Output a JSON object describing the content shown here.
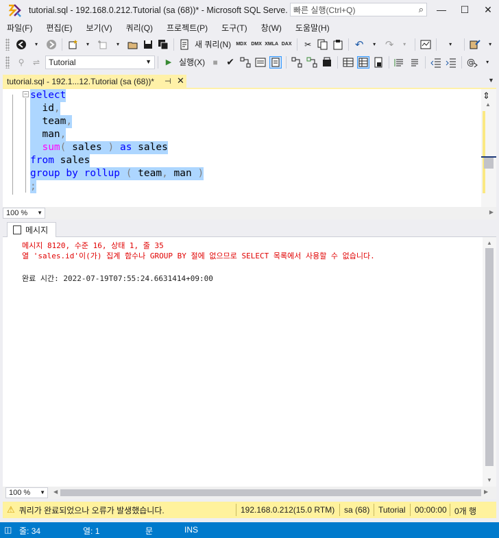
{
  "window": {
    "title": "tutorial.sql - 192.168.0.212.Tutorial (sa (68))* - Microsoft SQL Serve...",
    "quick_launch_placeholder": "빠른 실행(Ctrl+Q)",
    "minimize": "—",
    "maximize": "☐",
    "close": "✕"
  },
  "menu": [
    "파일(F)",
    "편집(E)",
    "보기(V)",
    "쿼리(Q)",
    "프로젝트(P)",
    "도구(T)",
    "창(W)",
    "도움말(H)"
  ],
  "toolbar": {
    "new_query_label": "새 쿼리(N)",
    "database": "Tutorial",
    "execute_label": "실행(X)",
    "icons_row1": [
      "back-icon",
      "forward-icon",
      "new-project-icon",
      "add-item-icon",
      "open-file-icon",
      "save-icon",
      "save-all-icon",
      "new-query-icon",
      "mdx-icon",
      "dmx-icon",
      "xmla-icon",
      "dax-icon",
      "cut-icon",
      "copy-icon",
      "paste-icon",
      "undo-icon",
      "redo-icon",
      "activity-monitor-icon",
      "properties-icon"
    ],
    "icons_row2": [
      "connect-icon",
      "change-connection-icon",
      "execute-icon",
      "stop-icon",
      "parse-icon",
      "display-plan-icon",
      "query-designer-icon",
      "results-to-text-icon",
      "results-to-grid-icon",
      "results-to-file-icon",
      "comment-icon",
      "uncomment-icon",
      "decrease-indent-icon",
      "increase-indent-icon",
      "specify-values-icon"
    ]
  },
  "document_tab": {
    "label": "tutorial.sql - 192.1...12.Tutorial (sa (68))*",
    "pin": "⊣",
    "close": "✕"
  },
  "editor": {
    "lines": [
      [
        {
          "t": "select",
          "c": "kw"
        }
      ],
      [
        {
          "t": "  id",
          "c": "tx"
        },
        {
          "t": ",",
          "c": "gr"
        }
      ],
      [
        {
          "t": "  team",
          "c": "tx"
        },
        {
          "t": ",",
          "c": "gr"
        }
      ],
      [
        {
          "t": "  man",
          "c": "tx"
        },
        {
          "t": ",",
          "c": "gr"
        }
      ],
      [
        {
          "t": "  sum",
          "c": "fn"
        },
        {
          "t": "(",
          "c": "gr"
        },
        {
          "t": " sales ",
          "c": "tx"
        },
        {
          "t": ")",
          "c": "gr"
        },
        {
          "t": " as",
          "c": "kw"
        },
        {
          "t": " sales",
          "c": "tx"
        }
      ],
      [
        {
          "t": "from",
          "c": "kw"
        },
        {
          "t": " sales",
          "c": "tx"
        }
      ],
      [
        {
          "t": "group",
          "c": "kw"
        },
        {
          "t": " by",
          "c": "kw"
        },
        {
          "t": " rollup",
          "c": "kw"
        },
        {
          "t": " (",
          "c": "gr"
        },
        {
          "t": " team",
          "c": "tx"
        },
        {
          "t": ",",
          "c": "gr"
        },
        {
          "t": " man",
          "c": "tx"
        },
        {
          "t": " )",
          "c": "gr"
        }
      ],
      [
        {
          "t": ";",
          "c": "gr"
        }
      ]
    ],
    "zoom": "100 %"
  },
  "results": {
    "tab_label": "메시지",
    "error_line1": "메시지 8120, 수준 16, 상태 1, 줄 35",
    "error_line2": "열 'sales.id'이(가) 집계 함수나 GROUP BY 절에 없으므로 SELECT 목록에서 사용할 수 없습니다.",
    "completion": "완료 시간: 2022-07-19T07:55:24.6631414+09:00",
    "zoom": "100 %"
  },
  "query_status": {
    "message": "쿼리가 완료되었으나 오류가 발생했습니다.",
    "server": "192.168.0.212(15.0 RTM)",
    "user": "sa (68)",
    "database": "Tutorial",
    "elapsed": "00:00:00",
    "rows": "0개 행"
  },
  "statusbar": {
    "line": "줄: 34",
    "col": "열: 1",
    "ch": "문",
    "mode": "INS"
  },
  "colors": {
    "accent": "#007acc",
    "tab_active": "#fff1a8",
    "selection": "#add6ff",
    "keyword": "#0000ff",
    "function": "#ff00ff",
    "error": "#e00000"
  }
}
